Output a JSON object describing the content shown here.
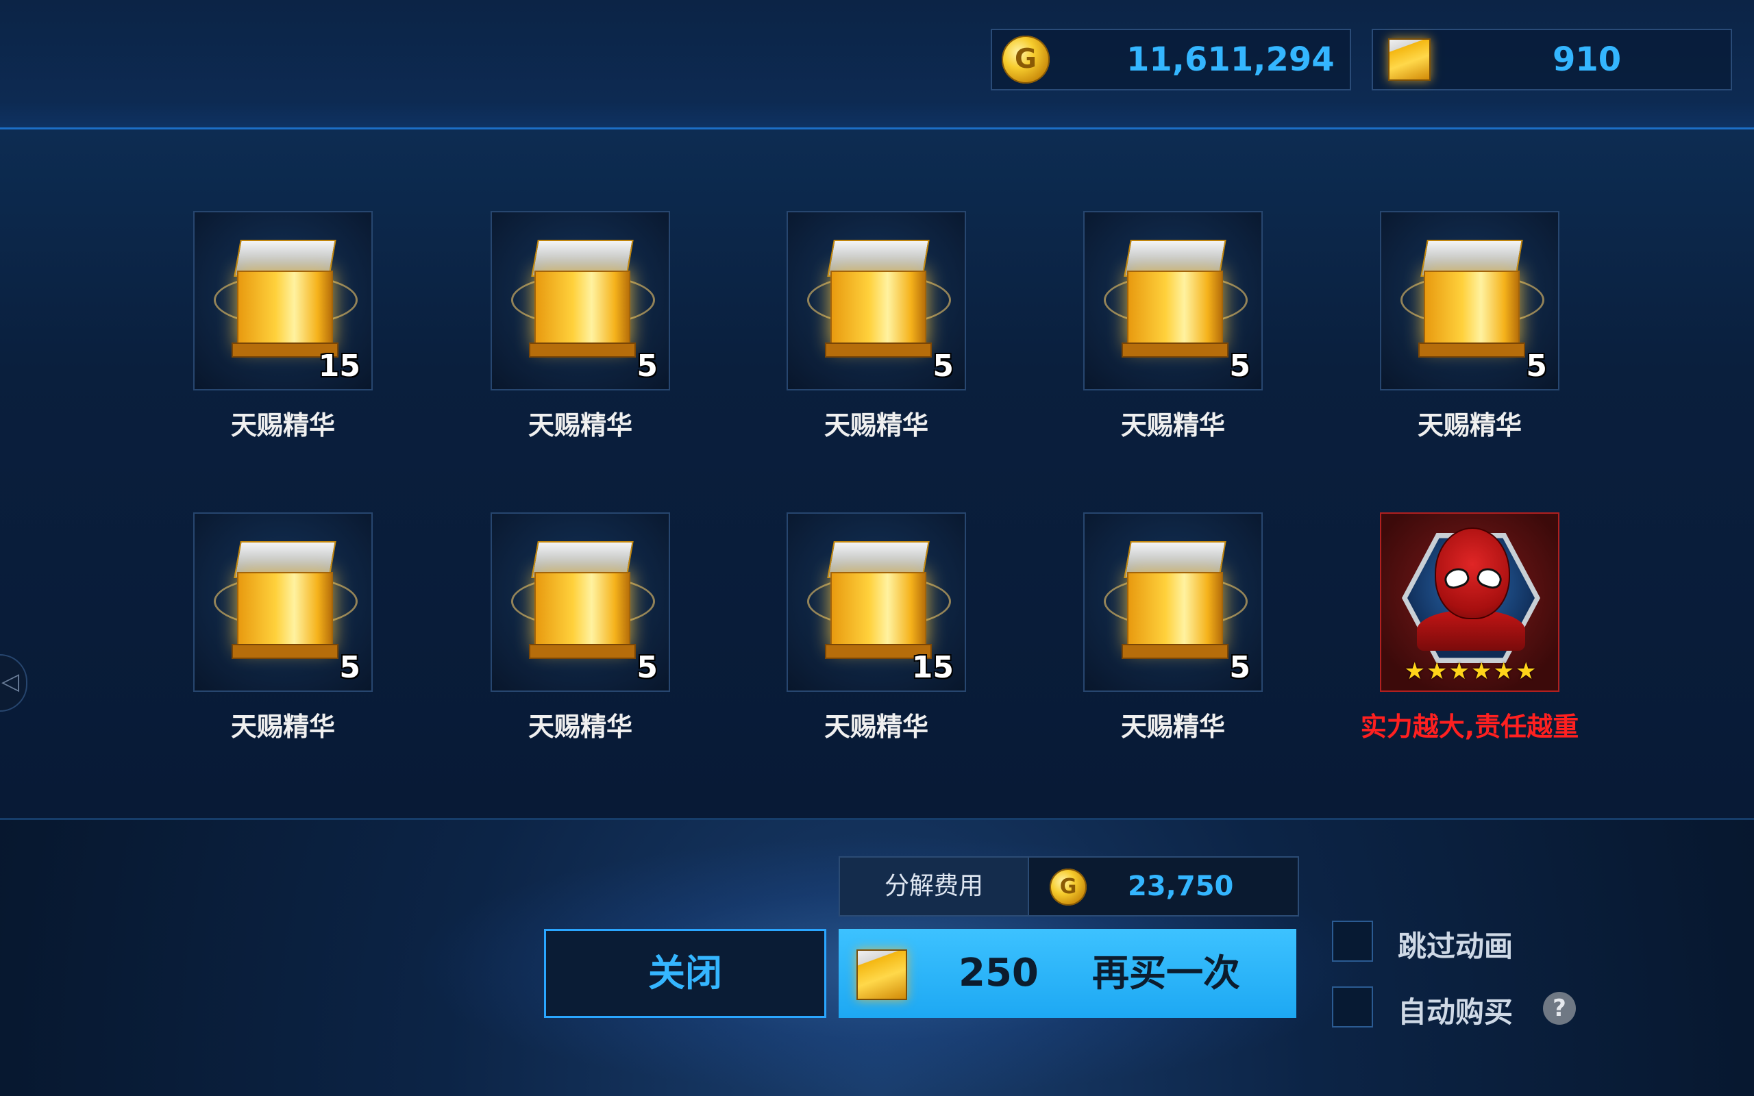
{
  "currencies": {
    "gold": "11,611,294",
    "cubes": "910"
  },
  "items": [
    {
      "label": "天赐精华",
      "count": "15",
      "type": "essence"
    },
    {
      "label": "天赐精华",
      "count": "5",
      "type": "essence"
    },
    {
      "label": "天赐精华",
      "count": "5",
      "type": "essence"
    },
    {
      "label": "天赐精华",
      "count": "5",
      "type": "essence"
    },
    {
      "label": "天赐精华",
      "count": "5",
      "type": "essence"
    },
    {
      "label": "天赐精华",
      "count": "5",
      "type": "essence"
    },
    {
      "label": "天赐精华",
      "count": "5",
      "type": "essence"
    },
    {
      "label": "天赐精华",
      "count": "15",
      "type": "essence"
    },
    {
      "label": "天赐精华",
      "count": "5",
      "type": "essence"
    },
    {
      "label": "实力越大,责任越重",
      "stars": "★★★★★★",
      "type": "hero",
      "star_count": 6
    }
  ],
  "decompose": {
    "label": "分解费用",
    "cost": "23,750"
  },
  "buttons": {
    "close": "关闭",
    "buy_again_cost": "250",
    "buy_again": "再买一次"
  },
  "options": {
    "skip_animation": "跳过动画",
    "auto_buy": "自动购买",
    "help": "?"
  },
  "colors": {
    "accent": "#34b6ff",
    "hero_label": "#ff2020",
    "buy_button": "#2bb6fb"
  }
}
